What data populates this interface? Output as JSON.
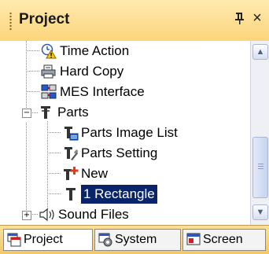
{
  "panel": {
    "title": "Project",
    "pin_glyph": "ᵖ",
    "close_glyph": "×"
  },
  "tree": {
    "items": [
      {
        "label": "Time Action",
        "icon": "time-action-icon",
        "selected": false
      },
      {
        "label": "Hard Copy",
        "icon": "hard-copy-icon",
        "selected": false
      },
      {
        "label": "MES Interface",
        "icon": "mes-interface-icon",
        "selected": false
      },
      {
        "label": "Parts",
        "icon": "parts-icon",
        "expander": "−",
        "selected": false
      },
      {
        "label": "Parts Image List",
        "icon": "parts-image-list-icon",
        "selected": false
      },
      {
        "label": "Parts Setting",
        "icon": "parts-setting-icon",
        "selected": false
      },
      {
        "label": "New",
        "icon": "new-part-icon",
        "selected": false
      },
      {
        "label": "1 Rectangle",
        "icon": "part-item-icon",
        "selected": true
      },
      {
        "label": "Sound Files",
        "icon": "sound-files-icon",
        "expander": "+",
        "selected": false
      }
    ]
  },
  "scrollbar": {
    "up_glyph": "▲",
    "down_glyph": "▼"
  },
  "tabs": [
    {
      "label": "Project",
      "icon": "project-tab-icon",
      "active": true
    },
    {
      "label": "System",
      "icon": "system-tab-icon",
      "active": false
    },
    {
      "label": "Screen",
      "icon": "screen-tab-icon",
      "active": false
    }
  ],
  "colors": {
    "title_bar": "#fbd57a",
    "selection": "#0a246a",
    "tab_bar": "#f4c765"
  }
}
